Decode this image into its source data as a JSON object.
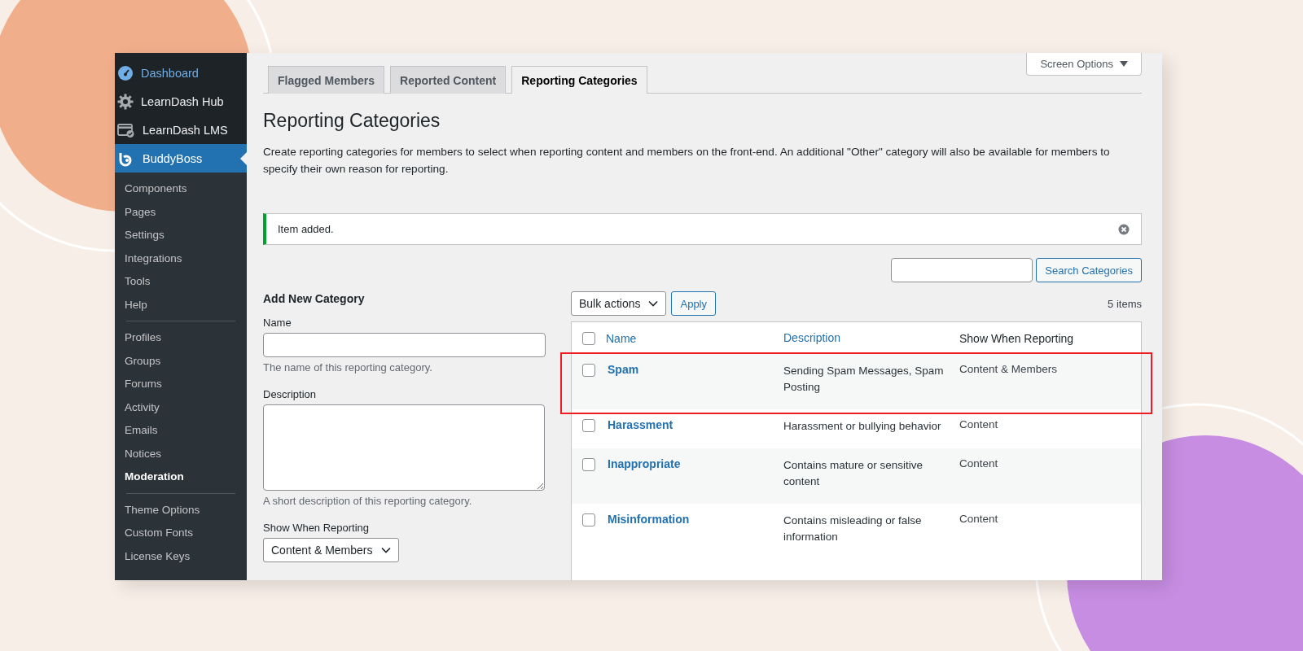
{
  "sidebar": {
    "items": [
      {
        "label": "Dashboard",
        "kind": "gauge",
        "selected": false,
        "hover": true
      },
      {
        "label": "LearnDash Hub",
        "kind": "gear",
        "selected": false,
        "hover": false
      },
      {
        "label": "LearnDash LMS",
        "kind": "card",
        "selected": false,
        "hover": false
      },
      {
        "label": "BuddyBoss",
        "kind": "logo",
        "selected": true,
        "hover": false
      }
    ],
    "submenu_groups": [
      {
        "items": [
          {
            "label": "Components",
            "selected": false
          },
          {
            "label": "Pages",
            "selected": false
          },
          {
            "label": "Settings",
            "selected": false
          },
          {
            "label": "Integrations",
            "selected": false
          },
          {
            "label": "Tools",
            "selected": false
          },
          {
            "label": "Help",
            "selected": false
          }
        ]
      },
      {
        "items": [
          {
            "label": "Profiles",
            "selected": false
          },
          {
            "label": "Groups",
            "selected": false
          },
          {
            "label": "Forums",
            "selected": false
          },
          {
            "label": "Activity",
            "selected": false
          },
          {
            "label": "Emails",
            "selected": false
          },
          {
            "label": "Notices",
            "selected": false
          },
          {
            "label": "Moderation",
            "selected": true
          }
        ]
      },
      {
        "items": [
          {
            "label": "Theme Options",
            "selected": false
          },
          {
            "label": "Custom Fonts",
            "selected": false
          },
          {
            "label": "License Keys",
            "selected": false
          }
        ]
      }
    ]
  },
  "screen_options": "Screen Options",
  "tabs": [
    {
      "label": "Flagged Members",
      "selected": false
    },
    {
      "label": "Reported Content",
      "selected": false
    },
    {
      "label": "Reporting Categories",
      "selected": true
    }
  ],
  "title": "Reporting Categories",
  "description": "Create reporting categories for members to select when reporting content and members on the front-end. An additional \"Other\" category will also be available for members to specify their own reason for reporting.",
  "notice": {
    "text": "Item added."
  },
  "form": {
    "heading": "Add New Category",
    "fields": [
      {
        "kind": "text",
        "label": "Name",
        "hint": "The name of this reporting category."
      },
      {
        "kind": "textarea",
        "label": "Description",
        "hint": "A short description of this reporting category."
      },
      {
        "kind": "select",
        "label": "Show When Reporting",
        "value": "Content & Members"
      }
    ]
  },
  "search_button": "Search Categories",
  "bulk_actions": "Bulk actions",
  "apply": "Apply",
  "item_count": "5 items",
  "table": {
    "columns": [
      {
        "label": "Name",
        "sortable": true
      },
      {
        "label": "Description",
        "sortable": true
      },
      {
        "label": "Show When Reporting",
        "sortable": false
      }
    ],
    "all_checked": false,
    "rows": [
      {
        "name": "Spam",
        "description": "Sending Spam Messages, Spam Posting",
        "show": "Content & Members",
        "checked": false,
        "highlighted": true
      },
      {
        "name": "Harassment",
        "description": "Harassment or bullying behavior",
        "show": "Content",
        "checked": false,
        "highlighted": false
      },
      {
        "name": "Inappropriate",
        "description": "Contains mature or sensitive content",
        "show": "Content",
        "checked": false,
        "highlighted": false
      },
      {
        "name": "Misinformation",
        "description": "Contains misleading or false information",
        "show": "Content",
        "checked": false,
        "highlighted": false
      }
    ]
  }
}
